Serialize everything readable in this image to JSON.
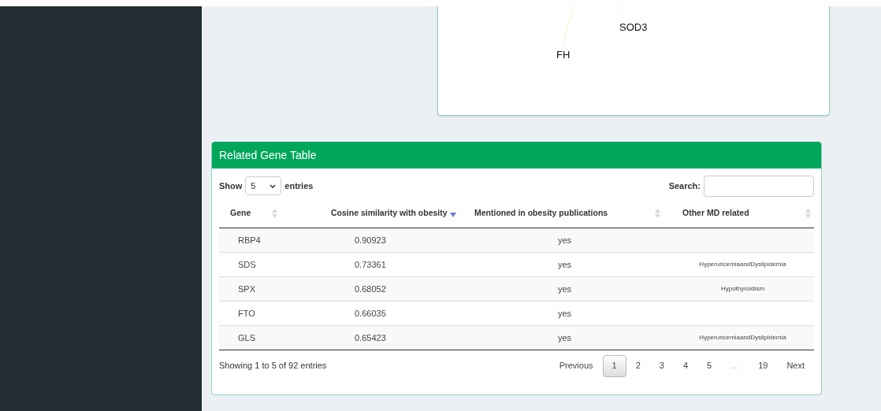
{
  "network": {
    "labels": [
      {
        "text": "SOD3"
      },
      {
        "text": "FH"
      }
    ]
  },
  "gene_table": {
    "title": "Related Gene Table",
    "length": {
      "prefix": "Show",
      "value": "5",
      "suffix": "entries"
    },
    "search": {
      "label": "Search:"
    },
    "columns": [
      {
        "label": "Gene",
        "sorted": false
      },
      {
        "label": "Cosine similarity with obesity",
        "sorted": true
      },
      {
        "label": "Mentioned in obesity publications",
        "sorted": false
      },
      {
        "label": "Other MD related",
        "sorted": false
      }
    ],
    "rows": [
      {
        "gene": "RBP4",
        "cosine": "0.90923",
        "mentioned": "yes",
        "other": ""
      },
      {
        "gene": "SDS",
        "cosine": "0.73361",
        "mentioned": "yes",
        "other": "HyperuricemiaandDyslipidemia"
      },
      {
        "gene": "SPX",
        "cosine": "0.68052",
        "mentioned": "yes",
        "other": "Hypothyroidism"
      },
      {
        "gene": "FTO",
        "cosine": "0.66035",
        "mentioned": "yes",
        "other": ""
      },
      {
        "gene": "GLS",
        "cosine": "0.65423",
        "mentioned": "yes",
        "other": "HyperuricemiaandDyslipidemia"
      }
    ],
    "info": "Showing 1 to 5 of 92 entries",
    "pagination": [
      {
        "label": "Previous",
        "kind": "nav",
        "selected": false
      },
      {
        "label": "1",
        "kind": "page",
        "selected": true
      },
      {
        "label": "2",
        "kind": "page",
        "selected": false
      },
      {
        "label": "3",
        "kind": "page",
        "selected": false
      },
      {
        "label": "4",
        "kind": "page",
        "selected": false
      },
      {
        "label": "5",
        "kind": "page",
        "selected": false
      },
      {
        "label": "…",
        "kind": "ellipsis",
        "selected": false
      },
      {
        "label": "19",
        "kind": "page",
        "selected": false
      },
      {
        "label": "Next",
        "kind": "nav",
        "selected": false
      }
    ]
  }
}
